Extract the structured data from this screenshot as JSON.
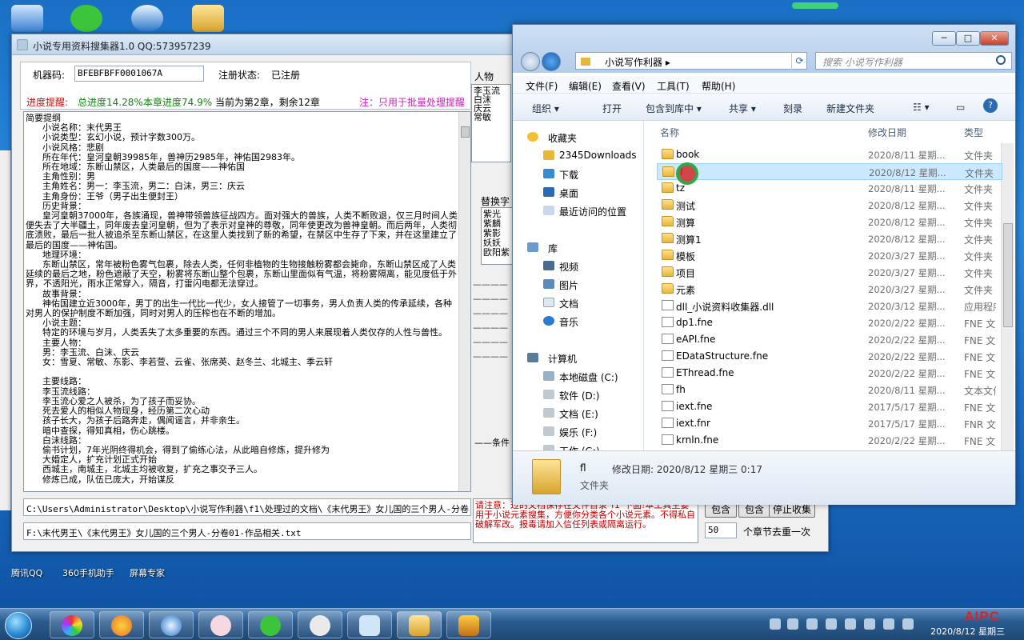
{
  "desktop": {
    "icons": [
      {
        "label": "腾讯QQ"
      },
      {
        "label": "360手机助手"
      },
      {
        "label": "屏幕专家"
      }
    ]
  },
  "app": {
    "title": "小说专用资料搜集器1.0   QQ:573957239",
    "machine_label": "机器码:",
    "machine_code": "BFEBFBFF0001067A",
    "reg_label": "注册状态:",
    "reg_value": "已注册",
    "progress_label": "进度提醒:",
    "progress_total": "总进度14.28%",
    "progress_chapter": "本章进度74.9%",
    "progress_current": "当前为第2章，剩余12章",
    "batch_note": "注：只用于批量处理提醒",
    "body_text": "简要提纲\n      小说名称：末代男王\n      小说类型：玄幻小说，预计字数300万。\n      小说风格：悲剧\n      所在年代：皇河皇朝39985年，兽神历2985年，神佑国2983年。\n      所在地域：东断山禁区，人类最后的国度——神佑国\n      主角性别：男\n      主角姓名：男一：李玉流，男二：白沫，男三：庆云\n      主角身份：王爷（男子出生便封王）\n      历史背景：\n      皇河皇朝37000年，各族涌现，兽神带领兽族征战四方。面对强大的兽族，人类不断败退，仅三月时间人类便失去了大半疆土，同年废去皇河皇朝，但为了表示对皇神的尊敬，同年使更改为兽神皇朝。而后两年，人类彻底溃败，最后一批人被追杀至东断山禁区，在这里人类找到了新的希望，在禁区中生存了下来，并在这里建立了最后的国度——神佑国。\n      地理环境：\n      东断山禁区，常年被粉色雾气包裹，除去人类，任何非植物的生物接触粉雾都会毙命，东断山禁区成了人类延续的最后之地，粉色遮蔽了天空，粉雾将东断山整个包裹，东断山里面似有气温，将粉雾隔离，能见度低于外界，不透阳光，雨水正常穿入，隔音，打雷闪电都无法穿过。\n      故事背景：\n      神佑国建立近3000年，男丁的出生一代比一代少，女人接管了一切事务，男人负责人类的传承延续，各种对男人的保护制度不断加强，同时对男人的压榨也在不断的增加。\n      小说主题：\n      特定的环境与岁月，人类丢失了太多重要的东西。通过三个不同的男人来展现着人类仅存的人性与兽性。\n      主要人物：\n      男：李玉流、白沫、庆云\n      女：雪夏、常敏、东影、李若萱、云雀、张席英、赵冬兰、北城主、季云轩\n\n      主要线路：\n      李玉流线路：\n      李玉流心爱之人被杀，为了孩子而妥协。\n      死去爱人的相似人物现身，经历第二次心动\n      孩子长大，为孩子后路奔走，偶闻谣言，并非亲生。\n      暗中查探，得知真相，伤心跳楼。\n      白沫线路：\n      偷书计划，7年光阴终得机会，得到了偷练心法，从此暗自修炼，提升修为\n      大婚定人，扩充计划正式开始\n      西城主，南城主，北城主均被收复，扩充之事交予三人。\n      修炼已成，队伍已庞大，开始谋反",
    "path1": "C:\\Users\\Administrator\\Desktop\\小说写作利器\\f1\\处理过的文档\\《末代男王》女儿国的三个男人-分卷",
    "path2": "F:\\末代男王\\《末代男王》女儿国的三个男人-分卷01-作品相关.txt",
    "side_people_label": "人物",
    "side_people": [
      "李玉流",
      "白沫",
      "庆云",
      "常敏"
    ],
    "replace_label": "替换字",
    "replace_items": [
      "紫光",
      "紫麟",
      "紫影",
      "妖妖",
      "欧阳紫"
    ],
    "dashes": [
      "————",
      "————",
      "————",
      "————",
      "————",
      "————"
    ],
    "condition_label": "——条件",
    "notice_text": "请注意：过的文档保存在文件目录\"f1\"下面!本工具主要用于小说元素搜集，方便你分类各个小说元素。不得私自破解军改。报毒请加入信任列表或隔离运行。",
    "btn_include1": "包含",
    "btn_include2": "包含",
    "btn_stop": "停止收集",
    "dedup_value": "50",
    "dedup_label": "个章节去重一次"
  },
  "explorer": {
    "path": "小说写作利器",
    "search_placeholder": "搜索 小说写作利器",
    "menu": [
      "文件(F)",
      "编辑(E)",
      "查看(V)",
      "工具(T)",
      "帮助(H)"
    ],
    "toolbar": [
      "组织 ▾",
      "打开",
      "包含到库中 ▾",
      "共享 ▾",
      "刻录",
      "新建文件夹"
    ],
    "nav": [
      "收藏夹",
      "2345Downloads",
      "下载",
      "桌面",
      "最近访问的位置",
      "库",
      "视频",
      "图片",
      "文档",
      "音乐",
      "计算机",
      "本地磁盘 (C:)",
      "软件 (D:)",
      "文档 (E:)",
      "娱乐 (F:)",
      "工作 (G:)"
    ],
    "columns": {
      "name": "名称",
      "date": "修改日期",
      "type": "类型"
    },
    "files": [
      {
        "name": "book",
        "date": "2020/8/11 星期...",
        "type": "文件夹",
        "kind": "folder"
      },
      {
        "name": "fl",
        "date": "2020/8/12 星期...",
        "type": "文件夹",
        "kind": "folder"
      },
      {
        "name": "tz",
        "date": "2020/8/11 星期...",
        "type": "文件夹",
        "kind": "folder"
      },
      {
        "name": "测试",
        "date": "2020/8/12 星期...",
        "type": "文件夹",
        "kind": "folder"
      },
      {
        "name": "测算",
        "date": "2020/8/12 星期...",
        "type": "文件夹",
        "kind": "folder"
      },
      {
        "name": "测算1",
        "date": "2020/8/12 星期...",
        "type": "文件夹",
        "kind": "folder"
      },
      {
        "name": "模板",
        "date": "2020/3/27 星期...",
        "type": "文件夹",
        "kind": "folder"
      },
      {
        "name": "项目",
        "date": "2020/3/27 星期...",
        "type": "文件夹",
        "kind": "folder"
      },
      {
        "name": "元素",
        "date": "2020/3/27 星期...",
        "type": "文件夹",
        "kind": "folder"
      },
      {
        "name": "dll_小说资料收集器.dll",
        "date": "2020/3/12 星期...",
        "type": "应用程序",
        "kind": "file"
      },
      {
        "name": "dp1.fne",
        "date": "2020/2/22 星期...",
        "type": "FNE 文",
        "kind": "file"
      },
      {
        "name": "eAPI.fne",
        "date": "2020/2/22 星期...",
        "type": "FNE 文",
        "kind": "file"
      },
      {
        "name": "EDataStructure.fne",
        "date": "2020/2/22 星期...",
        "type": "FNE 文",
        "kind": "file"
      },
      {
        "name": "EThread.fne",
        "date": "2020/2/22 星期...",
        "type": "FNE 文",
        "kind": "file"
      },
      {
        "name": "fh",
        "date": "2020/8/11 星期...",
        "type": "文本文件",
        "kind": "file"
      },
      {
        "name": "iext.fne",
        "date": "2017/5/17 星期...",
        "type": "FNE 文",
        "kind": "file"
      },
      {
        "name": "iext.fnr",
        "date": "2017/5/17 星期...",
        "type": "FNR 文",
        "kind": "file"
      },
      {
        "name": "krnln.fne",
        "date": "2020/2/22 星期...",
        "type": "FNE 文",
        "kind": "file"
      }
    ],
    "detail_name": "fl",
    "detail_meta": "修改日期: 2020/8/12 星期三 0:17",
    "detail_type": "文件夹"
  },
  "taskbar": {
    "clock": "2020/8/12 星期三",
    "brand": "AIPC"
  }
}
